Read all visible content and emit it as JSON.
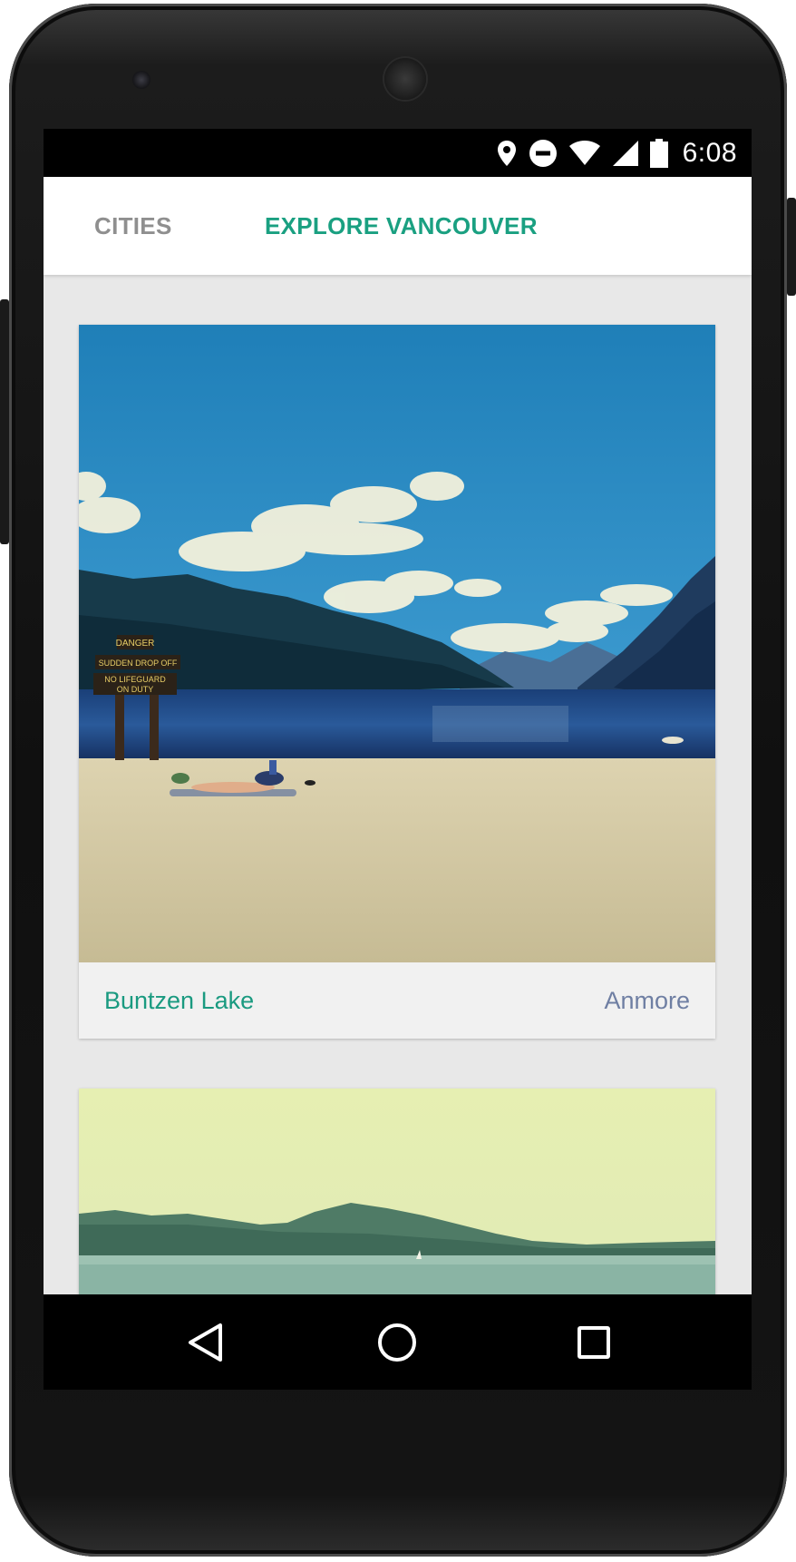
{
  "status_bar": {
    "time": "6:08",
    "icons": [
      "location-pin-icon",
      "do-not-disturb-icon",
      "wifi-icon",
      "cellular-signal-icon",
      "battery-icon"
    ]
  },
  "tabs": [
    {
      "label": "CITIES",
      "active": false
    },
    {
      "label": "EXPLORE VANCOUVER",
      "active": true
    }
  ],
  "places": [
    {
      "name": "Buntzen Lake",
      "area": "Anmore",
      "photo": "lake-beach-photo"
    },
    {
      "name": "",
      "area": "",
      "photo": "coastal-bay-photo"
    }
  ],
  "sign_text": {
    "line1": "DANGER",
    "line2": "SUDDEN DROP OFF",
    "line3": "NO LIFEGUARD",
    "line4": "ON DUTY"
  },
  "nav_bar": {
    "icons": [
      "back-icon",
      "home-icon",
      "recents-icon"
    ]
  },
  "colors": {
    "accent": "#1aa081",
    "inactive_tab": "#8f8f8f",
    "secondary_text": "#6f7fa3",
    "background": "#e8e8e8"
  }
}
